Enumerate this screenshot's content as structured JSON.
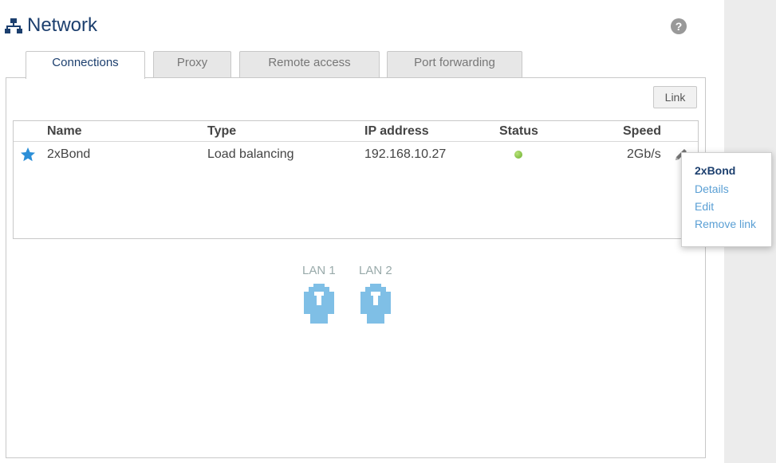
{
  "page": {
    "title": "Network",
    "help_label": "?"
  },
  "tabs": [
    {
      "label": "Connections",
      "active": true
    },
    {
      "label": "Proxy",
      "active": false
    },
    {
      "label": "Remote access",
      "active": false
    },
    {
      "label": "Port forwarding",
      "active": false
    }
  ],
  "toolbar": {
    "link_label": "Link"
  },
  "table": {
    "headers": [
      "Name",
      "Type",
      "IP address",
      "Status",
      "Speed"
    ],
    "rows": [
      {
        "name": "2xBond",
        "type": "Load balancing",
        "ip": "192.168.10.27",
        "status": "online",
        "speed": "2Gb/s"
      }
    ]
  },
  "ports": [
    {
      "label": "LAN 1"
    },
    {
      "label": "LAN 2"
    }
  ],
  "context_menu": {
    "title": "2xBond",
    "items": [
      "Details",
      "Edit",
      "Remove link"
    ]
  },
  "colors": {
    "accent": "#1c3f6e",
    "link": "#5a9fd4",
    "port": "#7fbfe6",
    "status_ok": "#6aae2d",
    "star": "#2c8fd8"
  },
  "icons": {
    "title": "network-icon",
    "help": "help-icon",
    "row_favorite": "star-icon",
    "row_edit": "pencil-icon",
    "port": "ethernet-port-icon"
  }
}
